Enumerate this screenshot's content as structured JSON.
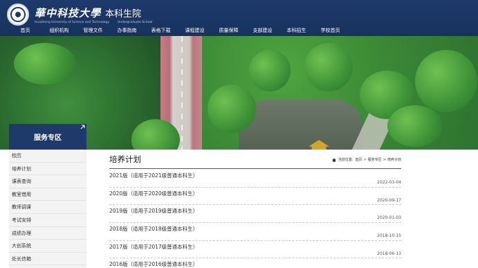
{
  "header": {
    "school_name_cn": "華中科技大學",
    "school_name_en": "Huazhong University of Science and Technology",
    "dept_name_cn": "本科生院",
    "dept_name_en": "Undergraduate School",
    "nav": [
      "首页",
      "组织机构",
      "管理文件",
      "办事指南",
      "表格下载",
      "课程建设",
      "质量保障",
      "支部建设",
      "本科招生",
      "学校首页"
    ]
  },
  "sidebar": {
    "title": "服务专区",
    "items": [
      "校历",
      "培养计划",
      "课表查询",
      "教室借用",
      "教师调课",
      "考试安排",
      "成绩办理",
      "大创系统",
      "处长信箱"
    ]
  },
  "main": {
    "title": "培养计划",
    "breadcrumb": {
      "prefix": "当前位置:",
      "items": [
        "首页",
        "服务专区",
        "培养计划"
      ],
      "separator": ">"
    },
    "rows": [
      {
        "title": "2021版（适用于2021级普通本科生）",
        "date": "2022-03-04"
      },
      {
        "title": "2020版（适用于2020级普通本科生）",
        "date": "2020-09-17"
      },
      {
        "title": "2019版（适用于2019级普通本科生）",
        "date": "2020-01-03"
      },
      {
        "title": "2018版（适用于2018级普通本科生）",
        "date": "2018-10-15"
      },
      {
        "title": "2017版（适用于2017级普通本科生）",
        "date": "2018-06-13"
      },
      {
        "title": "2016版（适用于2016级普通本科生）",
        "date": ""
      }
    ]
  },
  "icons": {
    "logo": "university-seal",
    "home": "home-icon",
    "expand": "expand-arrow-icon"
  },
  "colors": {
    "brand_blue": "#1d3a6b",
    "accent_gold": "#d4a52c"
  }
}
